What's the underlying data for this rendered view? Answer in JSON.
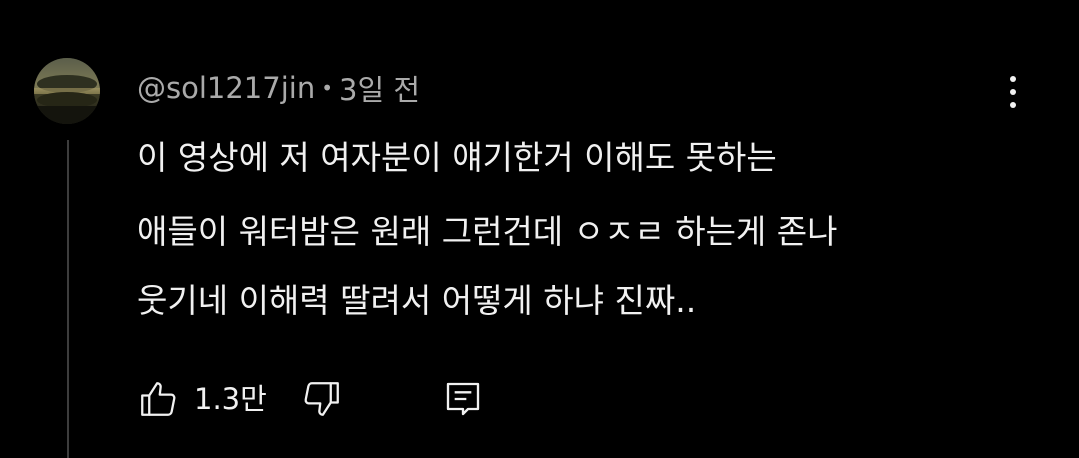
{
  "comment": {
    "author": "@sol1217jin",
    "separator": "•",
    "timestamp": "3일 전",
    "lines": [
      "이 영상에 저 여자분이 얘기한거 이해도 못하는",
      "애들이 워터밤은 원래 그런건데 ㅇㅈㄹ 하는게 존나",
      "웃기네 이해력 딸려서 어떻게 하냐 진짜.."
    ],
    "like_count": "1.3만"
  },
  "icons": {
    "avatar": "avatar-image",
    "menu": "more-vert-icon",
    "like": "thumb-up-icon",
    "dislike": "thumb-down-icon",
    "reply": "reply-comment-icon"
  },
  "colors": {
    "background": "#000000",
    "primary_text": "#f1f1f1",
    "secondary_text": "#aaaaaa",
    "thread_line": "#3d3d3d"
  }
}
